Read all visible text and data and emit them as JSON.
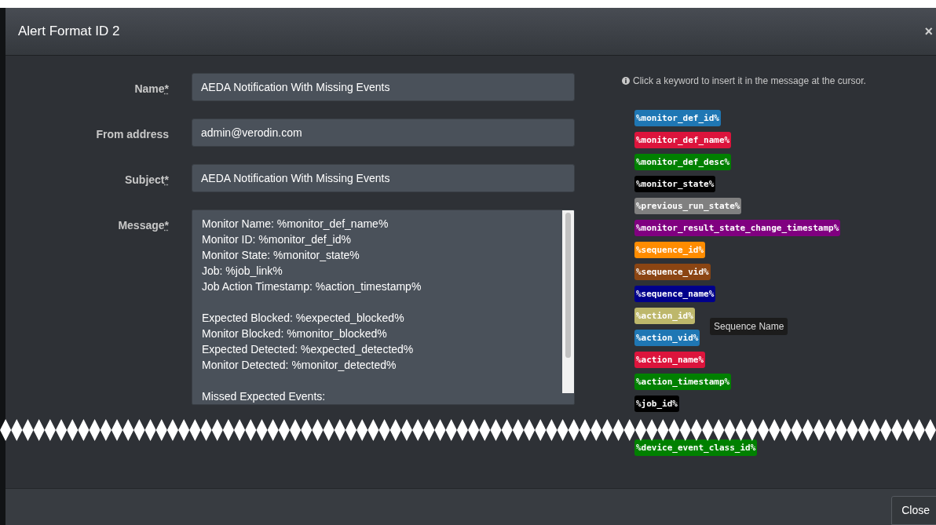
{
  "dialog": {
    "title": "Alert Format ID 2",
    "close_icon": "×"
  },
  "form": {
    "fields": [
      {
        "label": "Name",
        "required_mark": "*",
        "kind": "input",
        "value": "AEDA Notification With Missing Events"
      },
      {
        "label": "From address",
        "kind": "input",
        "value": "admin@verodin.com"
      },
      {
        "label": "Subject",
        "required_mark": "*",
        "kind": "input",
        "value": "AEDA Notification With Missing Events"
      },
      {
        "label": "Message",
        "required_mark": "*",
        "kind": "textarea",
        "paragraphs": [
          [
            "Monitor Name: %monitor_def_name%",
            "Monitor ID: %monitor_def_id%",
            "Monitor State: %monitor_state%",
            "Job: %job_link%",
            "Job Action Timestamp: %action_timestamp%"
          ],
          [
            "Expected Blocked: %expected_blocked%",
            "Monitor Blocked: %monitor_blocked%",
            "Expected Detected: %expected_detected%",
            "Monitor Detected: %monitor_detected%"
          ],
          [
            "Missed Expected Events:"
          ]
        ]
      }
    ]
  },
  "keywords": {
    "hint": "Click a keyword to insert it in the message at the cursor.",
    "items": [
      {
        "text": "%monitor_def_id%",
        "color": "#1f77b4"
      },
      {
        "text": "%monitor_def_name%",
        "color": "#dc143c"
      },
      {
        "text": "%monitor_def_desc%",
        "color": "#008000"
      },
      {
        "text": "%monitor_state%",
        "color": "#000000"
      },
      {
        "text": "%previous_run_state%",
        "color": "#808080"
      },
      {
        "text": "%monitor_result_state_change_timestamp%",
        "color": "#800080"
      },
      {
        "text": "%sequence_id%",
        "color": "#ff8c00"
      },
      {
        "text": "%sequence_vid%",
        "color": "#8b4513"
      },
      {
        "text": "%sequence_name%",
        "color": "#00008b",
        "tooltip": "Sequence Name"
      },
      {
        "text": "%action_id%",
        "color": "#bdb76b"
      },
      {
        "text": "%action_vid%",
        "color": "#1f77b4"
      },
      {
        "text": "%action_name%",
        "color": "#dc143c"
      },
      {
        "text": "%action_timestamp%",
        "color": "#008000"
      },
      {
        "text": "%job_id%",
        "color": "#000000"
      }
    ],
    "after_cut": [
      {
        "text": "%device_event_class_id%",
        "color": "#008000"
      }
    ]
  },
  "footer": {
    "buttons": [
      "Close"
    ]
  }
}
